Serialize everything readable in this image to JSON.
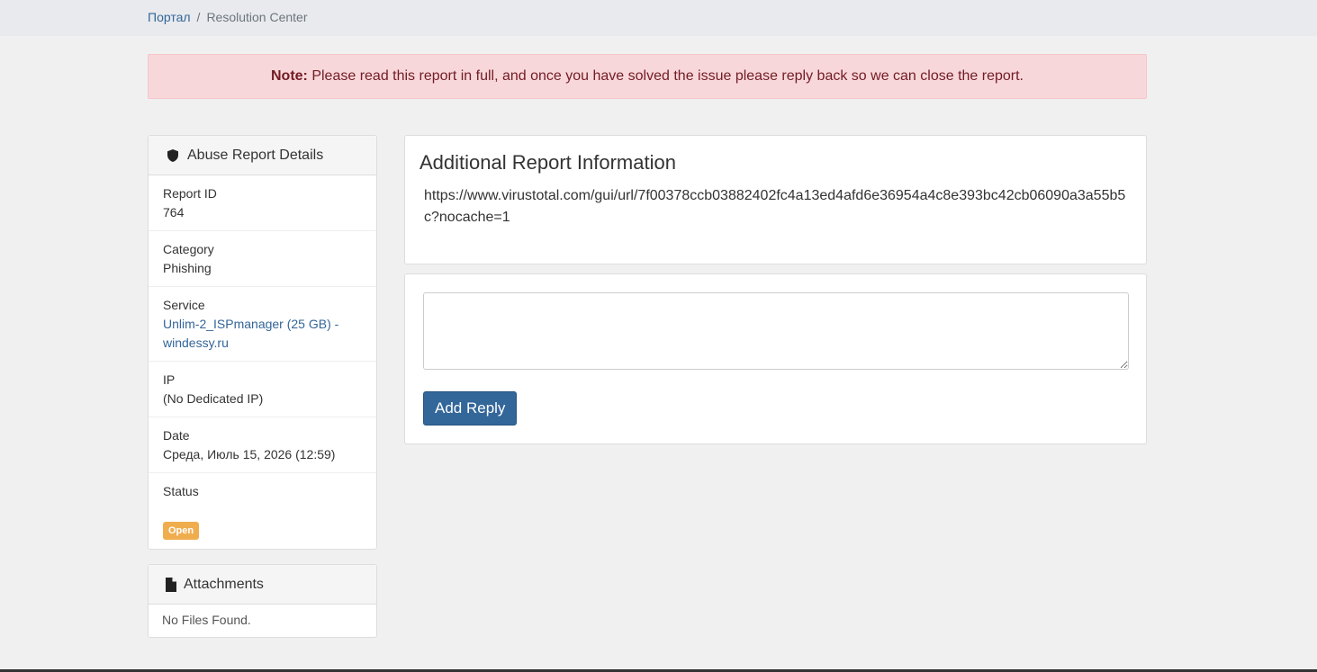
{
  "breadcrumb": {
    "home": "Портал",
    "separator": "/",
    "current": "Resolution Center"
  },
  "alert": {
    "strong": "Note:",
    "text": " Please read this report in full, and once you have solved the issue please reply back so we can close the report."
  },
  "details": {
    "title": "Abuse Report Details",
    "icon": "shield-icon",
    "items": [
      {
        "label": "Report ID",
        "value": "764"
      },
      {
        "label": "Category",
        "value": "Phishing"
      },
      {
        "label": "Service",
        "value": "Unlim-2_ISPmanager (25 GB) - windessy.ru"
      },
      {
        "label": "IP",
        "value": "(No Dedicated IP)"
      },
      {
        "label": "Date",
        "value": "Среда, Июль 15, 2026 (12:59)"
      },
      {
        "label": "Status",
        "value": "Open"
      }
    ]
  },
  "attachments": {
    "title": "Attachments",
    "icon": "file-icon",
    "empty": "No Files Found."
  },
  "info": {
    "title": "Additional Report Information",
    "url": "https://www.virustotal.com/gui/url/7f00378ccb03882402fc4a13ed4afd6e36954a4c8e393bc42cb06090a3a55b5c?nocache=1"
  },
  "reply": {
    "button": "Add Reply",
    "value": ""
  },
  "colors": {
    "link": "#336699",
    "badge": "#f0ad4e",
    "alert_bg": "#f8d7da",
    "button": "#336699"
  }
}
